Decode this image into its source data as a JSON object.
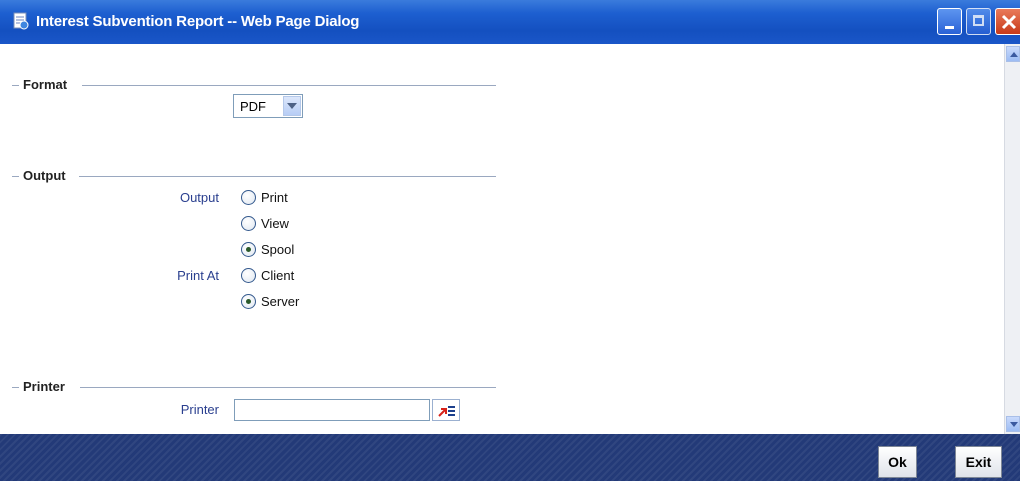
{
  "window": {
    "title": "Interest Subvention Report -- Web Page Dialog",
    "controls": [
      "minimize-icon",
      "maximize-icon",
      "close-icon"
    ]
  },
  "format_section": {
    "heading": "Format",
    "format_select": {
      "selected": "PDF"
    }
  },
  "output_section": {
    "heading": "Output",
    "output_label": "Output",
    "output_options": [
      {
        "label": "Print",
        "checked": false
      },
      {
        "label": "View",
        "checked": false
      },
      {
        "label": "Spool",
        "checked": true
      }
    ],
    "print_at_label": "Print At",
    "print_at_options": [
      {
        "label": "Client",
        "checked": false
      },
      {
        "label": "Server",
        "checked": true
      }
    ]
  },
  "printer_section": {
    "heading": "Printer",
    "printer_label": "Printer",
    "printer_value": "",
    "lov_icon": "list-of-values-icon"
  },
  "footer": {
    "ok_label": "Ok",
    "exit_label": "Exit"
  },
  "colors": {
    "title_bar": "#1d5fd0",
    "footer": "#233a78",
    "field_label": "#2a3f8f"
  }
}
